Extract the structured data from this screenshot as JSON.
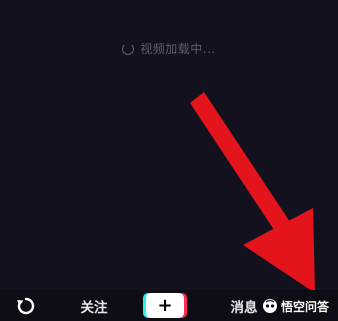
{
  "loading": {
    "text": "视频加载中..."
  },
  "tabbar": {
    "follow_label": "关注",
    "create_label": "+",
    "messages_label": "消息"
  },
  "watermark": {
    "text": "悟空问答"
  },
  "colors": {
    "background": "#12111d",
    "arrow": "#e3141c",
    "create_cyan": "#25f4ee",
    "create_red": "#fe2c55"
  },
  "icons": {
    "refresh": "refresh-icon",
    "spinner": "spinner-icon",
    "watermark_logo": "wukong-logo-icon"
  }
}
